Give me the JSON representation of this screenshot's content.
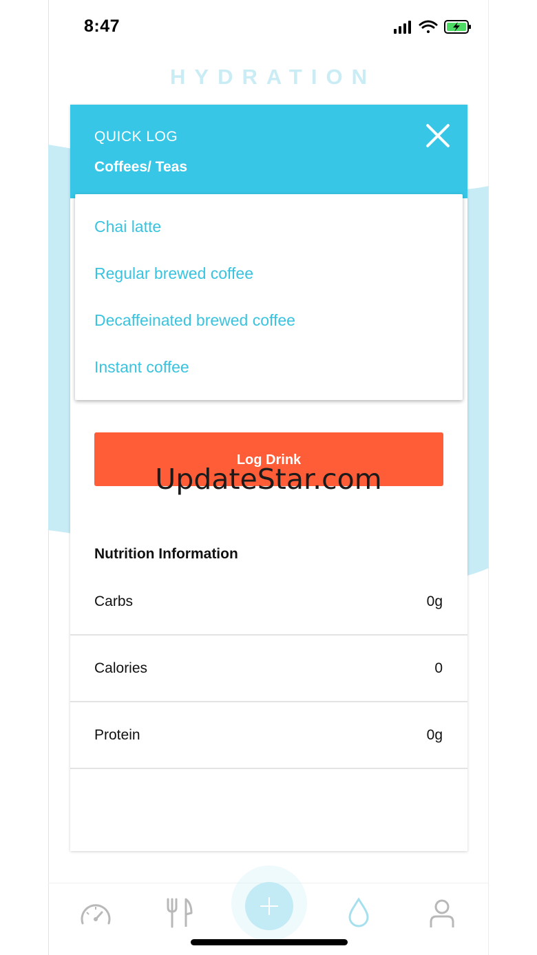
{
  "status_bar": {
    "time": "8:47"
  },
  "app": {
    "title": "HYDRATION"
  },
  "modal": {
    "kicker": "QUICK LOG",
    "category": "Coffees/ Teas",
    "dropdown_items": [
      {
        "label": "Chai latte"
      },
      {
        "label": "Regular brewed coffee"
      },
      {
        "label": "Decaffeinated brewed coffee"
      },
      {
        "label": "Instant coffee"
      }
    ],
    "log_button_label": "Log Drink",
    "nutrition": {
      "title": "Nutrition Information",
      "rows": [
        {
          "label": "Carbs",
          "value": "0g"
        },
        {
          "label": "Calories",
          "value": "0"
        },
        {
          "label": "Protein",
          "value": "0g"
        }
      ]
    }
  },
  "watermark": "UpdateStar.com",
  "bottom_nav": {
    "items": [
      {
        "icon": "dashboard-gauge-icon"
      },
      {
        "icon": "fork-knife-icon"
      },
      {
        "icon": "plus-icon"
      },
      {
        "icon": "water-drop-icon"
      },
      {
        "icon": "profile-icon"
      }
    ],
    "active_icon": "water-drop-icon"
  },
  "colors": {
    "accent": "#38c6e6",
    "link": "#39c3df",
    "button": "#ff5c38",
    "title_tint": "#c9ecf5",
    "wave": "#c7ecf6"
  }
}
